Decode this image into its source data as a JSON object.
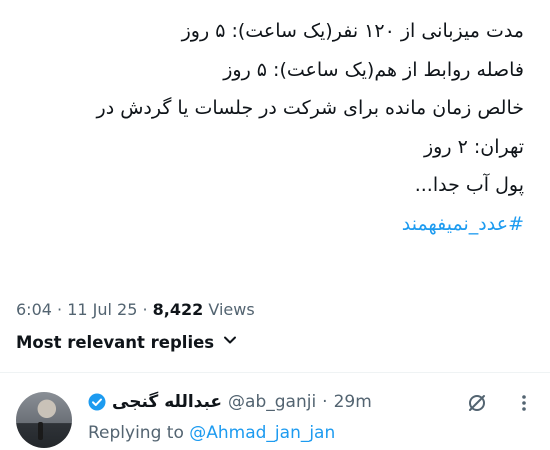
{
  "tweet": {
    "lines": [
      "مدت میزبانی از ۱۲۰ نفر(یک ساعت): ۵ روز",
      "فاصله روابط از هم(یک ساعت): ۵ روز",
      "خالص زمان مانده برای شرکت در جلسات یا گردش در",
      "تهران: ۲ روز",
      "پول آب جدا..."
    ],
    "hashtag": "#عدد_نمیفهمند",
    "time": "6:04",
    "date": "11 Jul 25",
    "views_count": "8,422",
    "views_label": "Views"
  },
  "replies_sort": {
    "label": "Most relevant replies",
    "icon": "chevron-down-icon"
  },
  "reply": {
    "display_name": "عبدالله گنجی",
    "handle": "@ab_ganji",
    "time_ago": "29m",
    "replying_prefix": "Replying to",
    "replying_to": "@Ahmad_jan_jan",
    "icons": [
      "verified-badge-icon",
      "grok-icon",
      "more-options-icon"
    ]
  },
  "colors": {
    "accent": "#1d9bf0",
    "text_primary": "#0f1419",
    "text_secondary": "#536471"
  }
}
